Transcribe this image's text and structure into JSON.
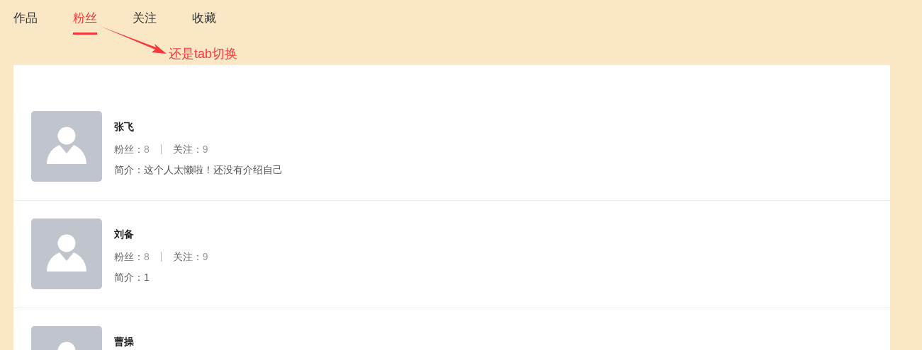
{
  "tabs": [
    {
      "label": "作品",
      "selected": false
    },
    {
      "label": "粉丝",
      "selected": true
    },
    {
      "label": "关注",
      "selected": false
    },
    {
      "label": "收藏",
      "selected": false
    }
  ],
  "annotation": {
    "text": "还是tab切换"
  },
  "users": [
    {
      "name": "张飞",
      "stats": [
        {
          "label": "粉丝：",
          "value": "8"
        },
        {
          "label": "关注：",
          "value": "9"
        }
      ],
      "bio": "简介：这个人太懒啦！还没有介绍自己"
    },
    {
      "name": "刘备",
      "stats": [
        {
          "label": "粉丝：",
          "value": "8"
        },
        {
          "label": "关注：",
          "value": "9"
        }
      ],
      "bio": "简介：1"
    },
    {
      "name": "曹操"
    }
  ]
}
